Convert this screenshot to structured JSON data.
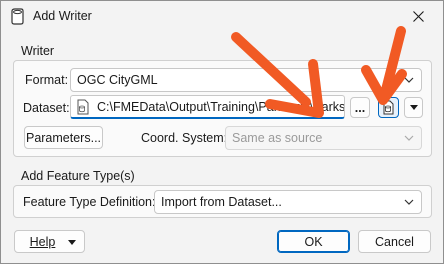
{
  "window": {
    "title": "Add Writer",
    "close_icon": "close-icon",
    "app_icon": "writer-app-icon"
  },
  "writer_group": {
    "label": "Writer",
    "format_label": "Format:",
    "format_value": "OGC CityGML",
    "dataset_label": "Dataset:",
    "dataset_value": "C:\\FMEData\\Output\\Training\\Parks.zip\\Parks",
    "browse_label": "...",
    "parameters_label": "Parameters...",
    "coord_system_label": "Coord. System:",
    "coord_system_value": "Same as source"
  },
  "feature_type_group": {
    "label": "Add Feature Type(s)",
    "definition_label": "Feature Type Definition:",
    "definition_value": "Import from Dataset..."
  },
  "footer": {
    "help_label": "Help",
    "ok_label": "OK",
    "cancel_label": "Cancel"
  },
  "colors": {
    "accent": "#0067c0",
    "annotation_arrow": "#f15a24"
  }
}
